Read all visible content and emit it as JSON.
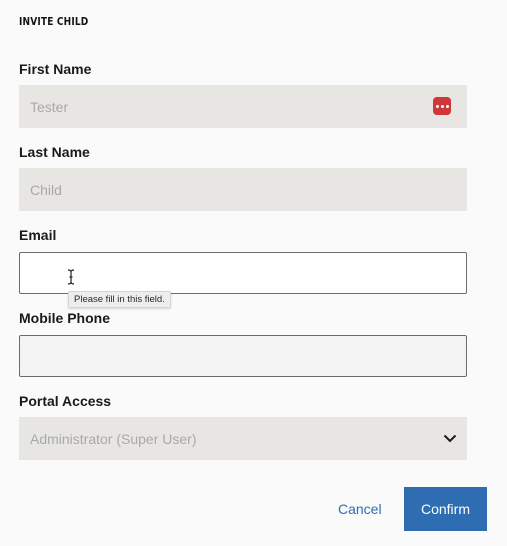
{
  "modal": {
    "title": "INVITE CHILD"
  },
  "fields": {
    "first_name": {
      "label": "First Name",
      "value": "Tester"
    },
    "last_name": {
      "label": "Last Name",
      "value": "Child"
    },
    "email": {
      "label": "Email",
      "value": "",
      "validation_tooltip": "Please fill in this field."
    },
    "mobile_phone": {
      "label": "Mobile Phone",
      "value": ""
    },
    "portal_access": {
      "label": "Portal Access",
      "selected": "Administrator (Super User)"
    }
  },
  "actions": {
    "cancel_label": "Cancel",
    "confirm_label": "Confirm"
  },
  "colors": {
    "accent": "#2e6db2",
    "password_manager_icon": "#d0373a"
  },
  "icons": {
    "password_manager": "dots-icon",
    "text_cursor": "i-beam-icon",
    "dropdown": "chevron-down-icon"
  }
}
